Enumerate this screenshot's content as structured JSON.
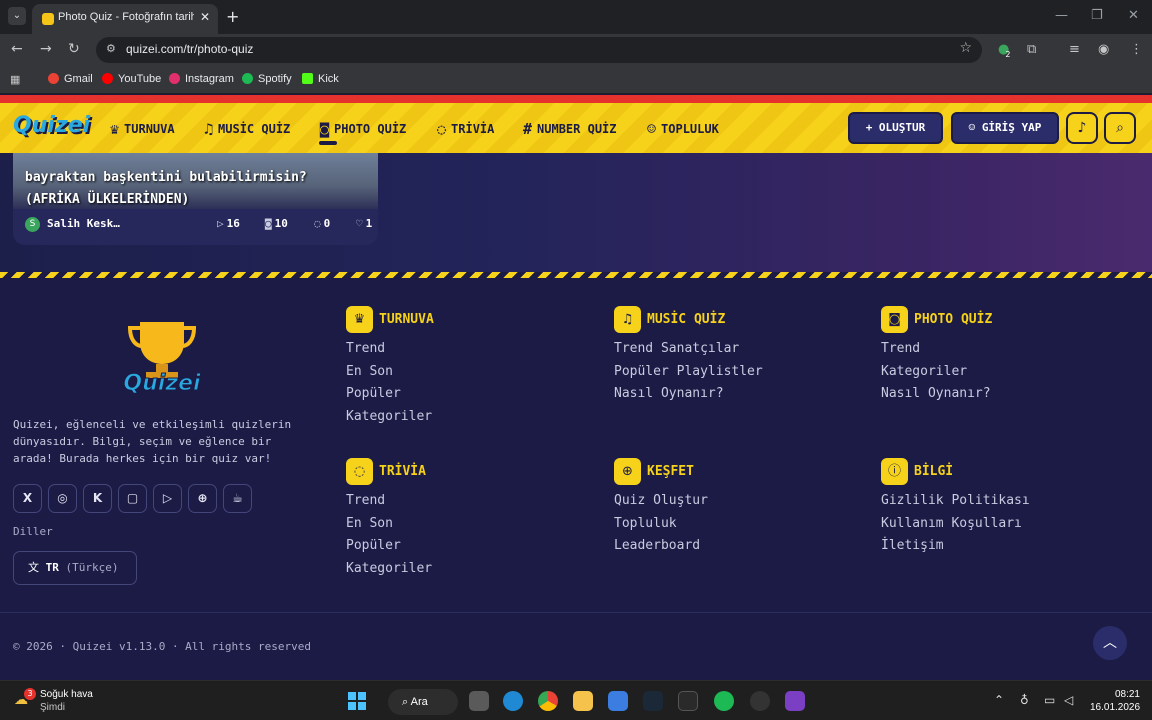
{
  "browser": {
    "tab_title": "Photo Quiz - Fotoğrafın tarihini",
    "url": "quizei.com/tr/photo-quiz",
    "bookmarks": [
      {
        "label": "Gmail",
        "color": "#ea4335"
      },
      {
        "label": "YouTube",
        "color": "#ff0000"
      },
      {
        "label": "Instagram",
        "color": "#e1306c"
      },
      {
        "label": "Spotify",
        "color": "#1db954"
      },
      {
        "label": "Kick",
        "color": "#53fc18"
      }
    ],
    "extension_badge": "2"
  },
  "navbar": {
    "logo": "Quizei",
    "items": [
      {
        "label": "TURNUVA",
        "icon": "trophy-icon"
      },
      {
        "label": "MUSİC QUİZ",
        "icon": "music-note-icon"
      },
      {
        "label": "PHOTO QUİZ",
        "icon": "camera-icon"
      },
      {
        "label": "TRİVİA",
        "icon": "chat-bubble-icon"
      },
      {
        "label": "NUMBER QUİZ",
        "icon": "hash-icon"
      },
      {
        "label": "TOPLULUK",
        "icon": "users-icon"
      }
    ],
    "create_label": "+ OLUŞTUR",
    "login_label": "GİRİŞ YAP"
  },
  "card": {
    "title": "bayraktan başkentini bulabilirmisin? (AFRİKA ÜLKELERİNDEN)",
    "author_initial": "S",
    "author": "Salih Kesk…",
    "plays": "16",
    "photos": "10",
    "comments": "0",
    "likes": "1"
  },
  "footer": {
    "logo": "Quizei",
    "description": "Quizei, eğlenceli ve etkileşimli quizlerin dünyasıdır. Bilgi, seçim ve eğlence bir arada! Burada herkes için bir quiz var!",
    "socials": [
      "x-icon",
      "instagram-icon",
      "kick-icon",
      "twitch-icon",
      "youtube-icon",
      "globe-icon",
      "coffee-icon"
    ],
    "languages_label": "Diller",
    "language_code": "TR",
    "language_name": "(Türkçe)",
    "columns": [
      {
        "title": "TURNUVA",
        "icon": "trophy-icon",
        "links": [
          "Trend",
          "En Son",
          "Popüler",
          "Kategoriler"
        ]
      },
      {
        "title": "MUSİC QUİZ",
        "icon": "music-note-icon",
        "links": [
          "Trend Sanatçılar",
          "Popüler Playlistler",
          "Nasıl Oynanır?"
        ]
      },
      {
        "title": "PHOTO QUİZ",
        "icon": "camera-icon",
        "links": [
          "Trend",
          "Kategoriler",
          "Nasıl Oynanır?"
        ]
      },
      {
        "title": "TRİVİA",
        "icon": "chat-bubble-icon",
        "links": [
          "Trend",
          "En Son",
          "Popüler",
          "Kategoriler"
        ]
      },
      {
        "title": "KEŞFET",
        "icon": "globe-icon",
        "links": [
          "Quiz Oluştur",
          "Topluluk",
          "Leaderboard"
        ]
      },
      {
        "title": "BİLGİ",
        "icon": "info-icon",
        "links": [
          "Gizlilik Politikası",
          "Kullanım Koşulları",
          "İletişim"
        ]
      }
    ],
    "copyright": "© 2026 · Quizei v1.13.0 · All rights reserved"
  },
  "taskbar": {
    "weather_title": "Soğuk hava",
    "weather_sub": "Şimdi",
    "weather_badge": "3",
    "search_label": "Ara",
    "time": "08:21",
    "date": "16.01.2026"
  }
}
